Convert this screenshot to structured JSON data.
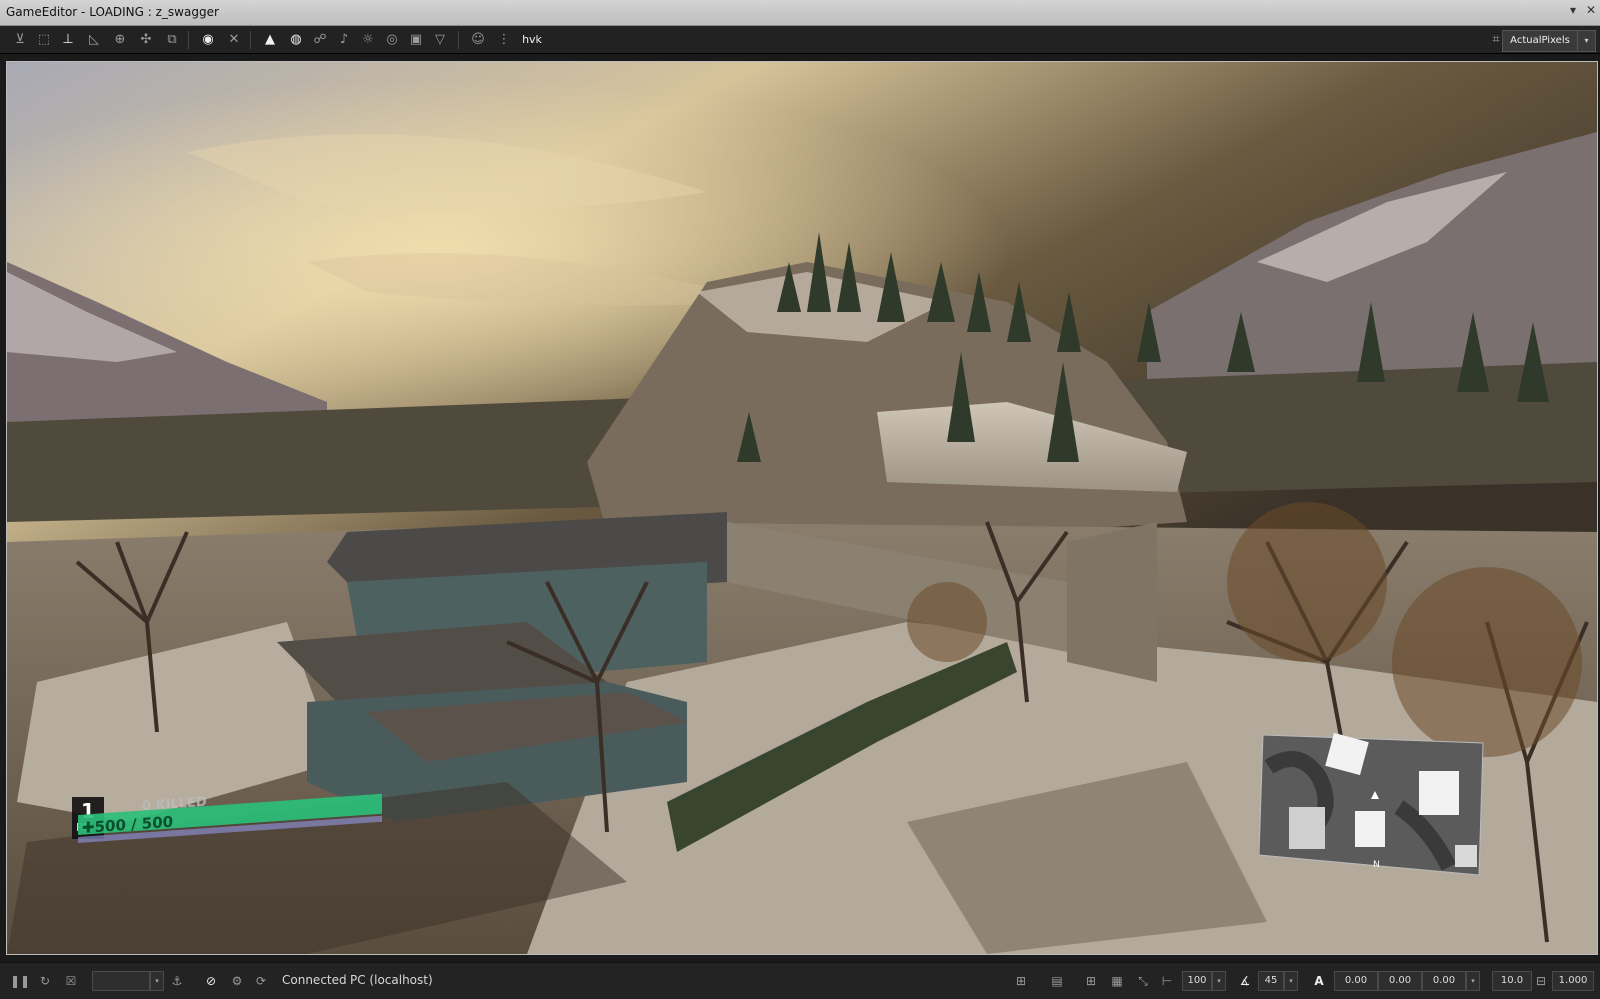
{
  "window": {
    "title": "GameEditor - LOADING : z_swagger"
  },
  "toolbar": {
    "icons": [
      "vertex-snap-icon",
      "select-icon",
      "axis-icon",
      "angle-icon",
      "pivot-icon",
      "move-icon",
      "scale-icon",
      "eye-icon",
      "wrench-icon",
      "tree-icon",
      "cloud-icon",
      "character-icon",
      "sound-icon",
      "light-icon",
      "ball-icon",
      "box-icon",
      "v-icon",
      "person-icon",
      "grid-icon",
      "hvk-icon"
    ],
    "hvk_label": "hvk",
    "resolution_value": "ActualPixels"
  },
  "hud": {
    "level": "1",
    "pp_label": "PP",
    "killed_text": "0 KILLED",
    "health_text": "500 / 500",
    "health_fraction": 1.0
  },
  "minimap": {
    "north_label": "N"
  },
  "statusbar": {
    "connected_label": "Connected",
    "target_label": "PC (localhost)",
    "grid_value": "100",
    "angle_value": "45",
    "coord_x": "0.00",
    "coord_y": "0.00",
    "coord_z": "0.00",
    "speed_value": "10.0",
    "scale_value": "1.000"
  }
}
